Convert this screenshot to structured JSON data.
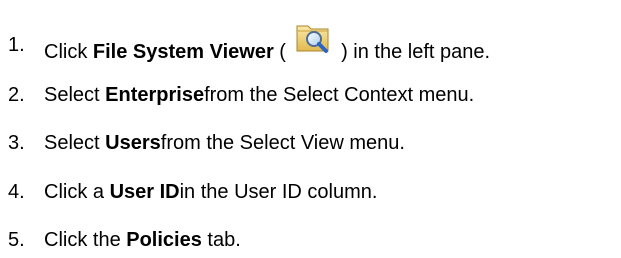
{
  "steps": [
    {
      "number": "1.",
      "prefix": "Click ",
      "bold": "File System Viewer",
      "middle": " ( ",
      "icon": "folder-search-icon",
      "suffix": " ) in the left pane."
    },
    {
      "number": "2.",
      "prefix": "Select ",
      "bold": "Enterprise",
      "suffix": "from the Select Context menu."
    },
    {
      "number": "3.",
      "prefix": "Select ",
      "bold": "Users",
      "suffix": "from the Select View menu."
    },
    {
      "number": "4.",
      "prefix": "Click a ",
      "bold": "User ID",
      "suffix": "in the User ID column."
    },
    {
      "number": "5.",
      "prefix": "Click the ",
      "bold": "Policies",
      "suffix": " tab."
    }
  ]
}
